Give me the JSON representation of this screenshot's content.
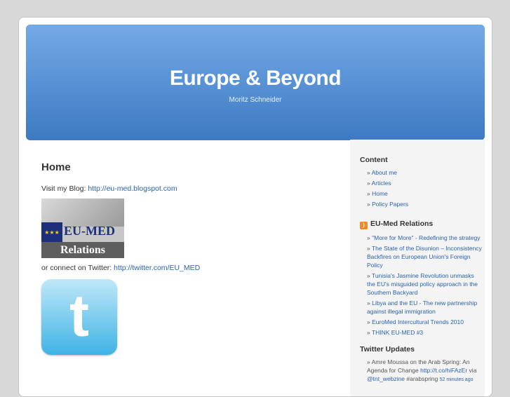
{
  "site": {
    "title": "Europe & Beyond",
    "description": "Moritz Schneider"
  },
  "main": {
    "heading": "Home",
    "blog_prefix": "Visit my Blog: ",
    "blog_link": "http://eu-med.blogspot.com",
    "logo_top": "EU-MED",
    "logo_bottom": "Relations",
    "twitter_prefix": "or connect on Twitter: ",
    "twitter_link": "http://twitter.com/EU_MED"
  },
  "sidebar": {
    "content_title": "Content",
    "content_items": [
      "About me",
      "Articles",
      "Home",
      "Policy Papers"
    ],
    "feed_title": "EU-Med Relations",
    "feed_items": [
      "\"More for More\" - Redefining the strategy",
      "The State of the Disunion – Inconsistency Backfires on European Union's Foreign Policy",
      "Tunisia's Jasmine Revolution unmasks the EU's misguided policy approach in the Southern Backyard",
      "Libya and the EU - The new partnership against illegal immigration",
      "EuroMed Intercultural Trends 2010",
      "THINK EU-MED #3"
    ],
    "twitter_title": "Twitter Updates",
    "tweet": {
      "text": "Amre Moussa on the Arab Spring: An Agenda for Change ",
      "link": "http://t.co/hiFAzEr",
      "via": " via ",
      "handle": "@tnt_webzine",
      "tag": " #arabspring ",
      "time": "52 minutes ago"
    }
  }
}
